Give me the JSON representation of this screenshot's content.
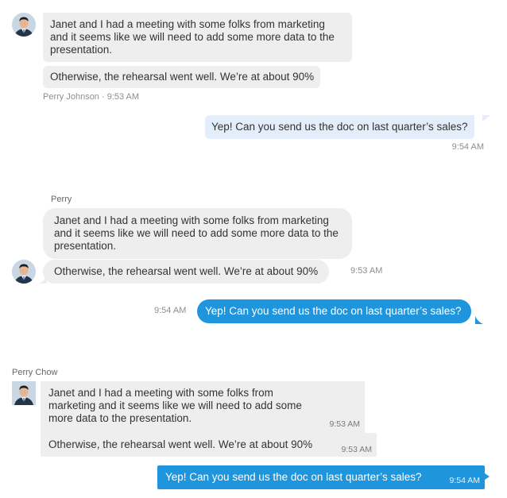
{
  "colors": {
    "grey_bubble": "#eeeeee",
    "light_blue_bubble": "#e3eefa",
    "blue_bubble": "#1e95dc",
    "meta_text": "#8e8e8e"
  },
  "style1": {
    "msg1": "Janet and I had a meeting with some folks from marketing and it seems like we will need to add some more data to the presentation.",
    "msg2": "Otherwise, the rehearsal went well. We’re at about 90%",
    "sender_meta": "Perry Johnson · 9:53 AM",
    "reply": "Yep! Can you send us the doc on last quarter’s sales?",
    "reply_time": "9:54 AM"
  },
  "style2": {
    "sender": "Perry",
    "msg1": "Janet and I had a meeting with some folks from marketing and it seems like we will need to add some more data to the presentation.",
    "msg2": "Otherwise, the rehearsal went well. We’re at about 90%",
    "msg2_time": "9:53 AM",
    "reply_time": "9:54 AM",
    "reply": "Yep! Can you send us the doc on last quarter’s sales?"
  },
  "style3": {
    "sender": "Perry Chow",
    "msg1": "Janet and I had a meeting with some folks from marketing and it seems like we will need to add some more data to the presentation.",
    "msg1_time": "9:53 AM",
    "msg2": "Otherwise, the rehearsal went well. We’re at about 90%",
    "msg2_time": "9:53 AM",
    "reply": "Yep! Can you send us the doc on last quarter’s sales?",
    "reply_time": "9:54 AM"
  }
}
